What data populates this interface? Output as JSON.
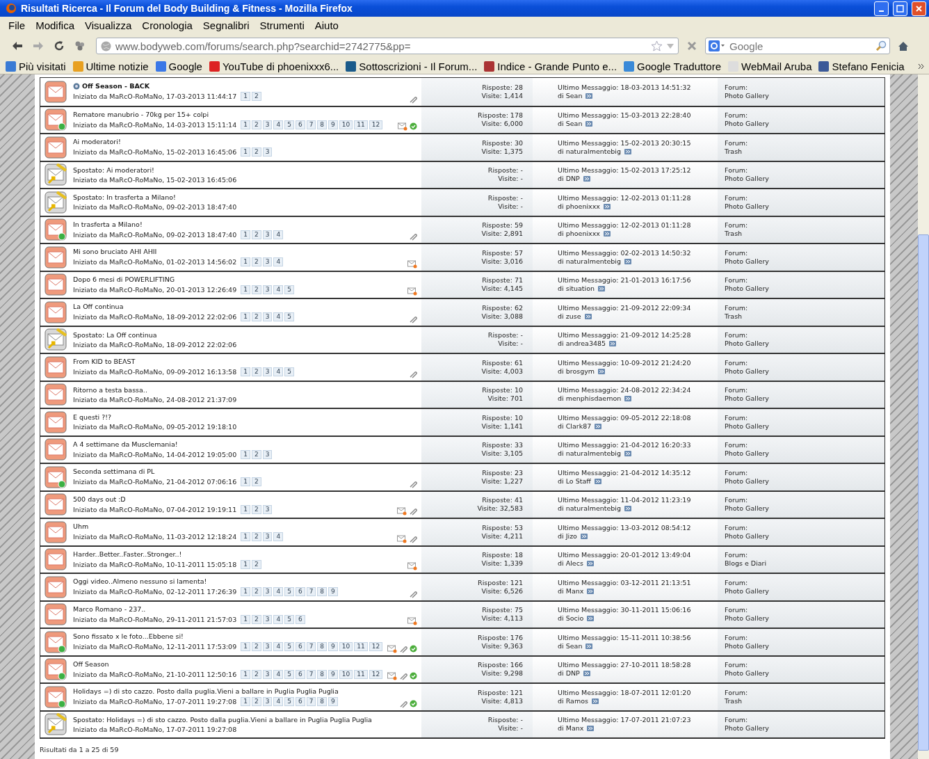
{
  "window": {
    "title": "Risultati Ricerca - Il Forum del Body Building & Fitness - Mozilla Firefox"
  },
  "menu": [
    "File",
    "Modifica",
    "Visualizza",
    "Cronologia",
    "Segnalibri",
    "Strumenti",
    "Aiuto"
  ],
  "address_bar": {
    "value": "www.bodyweb.com/forums/search.php?searchid=2742775&pp="
  },
  "search": {
    "placeholder": "Google"
  },
  "bookmarks": [
    "Più visitati",
    "Ultime notizie",
    "Google",
    "YouTube di phoenixxx6...",
    "Sottoscrizioni - Il Forum...",
    "Indice - Grande Punto e...",
    "Google Traduttore",
    "WebMail Aruba",
    "Stefano Fenicia"
  ],
  "threads": [
    {
      "kind": "topic",
      "unread": false,
      "highlighted": true,
      "title": "Off Season - BACK",
      "started": "Iniziato da MaRcO-RoMaNo, 17-03-2013 11:44:17",
      "pages": [
        "1",
        "2"
      ],
      "subscribed": false,
      "attachment": true,
      "posted": false,
      "replies": "Risposte: 28",
      "views": "Visite: 1,414",
      "last": "Ultimo Messaggio: 18-03-2013 14:51:32",
      "last_by": "di Sean",
      "forum_label": "Forum:",
      "forum": "Photo Gallery"
    },
    {
      "kind": "topic",
      "unread": true,
      "highlighted": false,
      "title": "Rematore manubrio - 70kg per 15+ colpi",
      "started": "Iniziato da MaRcO-RoMaNo, 14-03-2013 15:11:14",
      "pages": [
        "1",
        "2",
        "3",
        "4",
        "5",
        "6",
        "7",
        "8",
        "9",
        "10",
        "11",
        "12"
      ],
      "subscribed": true,
      "attachment": false,
      "posted": true,
      "replies": "Risposte: 178",
      "views": "Visite: 6,000",
      "last": "Ultimo Messaggio: 15-03-2013 22:28:40",
      "last_by": "di Sean",
      "forum_label": "Forum:",
      "forum": "Photo Gallery"
    },
    {
      "kind": "topic",
      "unread": false,
      "highlighted": false,
      "title": "Ai moderatori!",
      "started": "Iniziato da MaRcO-RoMaNo, 15-02-2013 16:45:06",
      "pages": [
        "1",
        "2",
        "3"
      ],
      "subscribed": false,
      "attachment": false,
      "posted": false,
      "replies": "Risposte: 30",
      "views": "Visite: 1,375",
      "last": "Ultimo Messaggio: 15-02-2013 20:30:15",
      "last_by": "di naturalmentebig",
      "forum_label": "Forum:",
      "forum": "Trash"
    },
    {
      "kind": "moved",
      "unread": false,
      "highlighted": false,
      "title": "Spostato: Ai moderatori!",
      "started": "Iniziato da MaRcO-RoMaNo, 15-02-2013 16:45:06",
      "subscribed": false,
      "attachment": false,
      "posted": false,
      "replies": "Risposte: -",
      "views": "Visite: -",
      "last": "Ultimo Messaggio: 15-02-2013 17:25:12",
      "last_by": "di DNP",
      "forum_label": "Forum:",
      "forum": "Photo Gallery"
    },
    {
      "kind": "moved",
      "unread": false,
      "highlighted": false,
      "title": "Spostato: In trasferta a Milano!",
      "started": "Iniziato da MaRcO-RoMaNo, 09-02-2013 18:47:40",
      "subscribed": false,
      "attachment": false,
      "posted": false,
      "replies": "Risposte: -",
      "views": "Visite: -",
      "last": "Ultimo Messaggio: 12-02-2013 01:11:28",
      "last_by": "di phoenixxx",
      "forum_label": "Forum:",
      "forum": "Photo Gallery"
    },
    {
      "kind": "topic",
      "unread": true,
      "highlighted": false,
      "title": "In trasferta a Milano!",
      "started": "Iniziato da MaRcO-RoMaNo, 09-02-2013 18:47:40",
      "pages": [
        "1",
        "2",
        "3",
        "4"
      ],
      "subscribed": false,
      "attachment": true,
      "posted": false,
      "replies": "Risposte: 59",
      "views": "Visite: 2,891",
      "last": "Ultimo Messaggio: 12-02-2013 01:11:28",
      "last_by": "di phoenixxx",
      "forum_label": "Forum:",
      "forum": "Trash"
    },
    {
      "kind": "topic",
      "unread": false,
      "highlighted": false,
      "title": "Mi sono bruciato AHI AHII",
      "started": "Iniziato da MaRcO-RoMaNo, 01-02-2013 14:56:02",
      "pages": [
        "1",
        "2",
        "3",
        "4"
      ],
      "subscribed": true,
      "attachment": false,
      "posted": false,
      "replies": "Risposte: 57",
      "views": "Visite: 3,016",
      "last": "Ultimo Messaggio: 02-02-2013 14:50:32",
      "last_by": "di naturalmentebig",
      "forum_label": "Forum:",
      "forum": "Photo Gallery"
    },
    {
      "kind": "topic",
      "unread": false,
      "highlighted": false,
      "title": "Dopo 6 mesi di POWERLIFTING",
      "started": "Iniziato da MaRcO-RoMaNo, 20-01-2013 12:26:49",
      "pages": [
        "1",
        "2",
        "3",
        "4",
        "5"
      ],
      "subscribed": true,
      "attachment": false,
      "posted": false,
      "replies": "Risposte: 71",
      "views": "Visite: 4,145",
      "last": "Ultimo Messaggio: 21-01-2013 16:17:56",
      "last_by": "di situation",
      "forum_label": "Forum:",
      "forum": "Photo Gallery"
    },
    {
      "kind": "topic",
      "unread": false,
      "highlighted": false,
      "title": "La Off continua",
      "started": "Iniziato da MaRcO-RoMaNo, 18-09-2012 22:02:06",
      "pages": [
        "1",
        "2",
        "3",
        "4",
        "5"
      ],
      "subscribed": false,
      "attachment": true,
      "posted": false,
      "replies": "Risposte: 62",
      "views": "Visite: 3,088",
      "last": "Ultimo Messaggio: 21-09-2012 22:09:34",
      "last_by": "di zuse",
      "forum_label": "Forum:",
      "forum": "Trash"
    },
    {
      "kind": "moved",
      "unread": false,
      "highlighted": false,
      "title": "Spostato: La Off continua",
      "started": "Iniziato da MaRcO-RoMaNo, 18-09-2012 22:02:06",
      "subscribed": false,
      "attachment": false,
      "posted": false,
      "replies": "Risposte: -",
      "views": "Visite: -",
      "last": "Ultimo Messaggio: 21-09-2012 14:25:28",
      "last_by": "di andrea3485",
      "forum_label": "Forum:",
      "forum": "Photo Gallery"
    },
    {
      "kind": "topic",
      "unread": false,
      "highlighted": false,
      "title": "From KID to BEAST",
      "started": "Iniziato da MaRcO-RoMaNo, 09-09-2012 16:13:58",
      "pages": [
        "1",
        "2",
        "3",
        "4",
        "5"
      ],
      "subscribed": false,
      "attachment": true,
      "posted": false,
      "replies": "Risposte: 61",
      "views": "Visite: 4,003",
      "last": "Ultimo Messaggio: 10-09-2012 21:24:20",
      "last_by": "di brosgym",
      "forum_label": "Forum:",
      "forum": "Photo Gallery"
    },
    {
      "kind": "topic",
      "unread": false,
      "highlighted": false,
      "title": "Ritorno a testa bassa..",
      "started": "Iniziato da MaRcO-RoMaNo, 24-08-2012 21:37:09",
      "subscribed": false,
      "attachment": false,
      "posted": false,
      "replies": "Risposte: 10",
      "views": "Visite: 701",
      "last": "Ultimo Messaggio: 24-08-2012 22:34:24",
      "last_by": "di menphisdaemon",
      "forum_label": "Forum:",
      "forum": "Photo Gallery"
    },
    {
      "kind": "topic",
      "unread": false,
      "highlighted": false,
      "title": "E questi ?!?",
      "started": "Iniziato da MaRcO-RoMaNo, 09-05-2012 19:18:10",
      "subscribed": false,
      "attachment": false,
      "posted": false,
      "replies": "Risposte: 10",
      "views": "Visite: 1,141",
      "last": "Ultimo Messaggio: 09-05-2012 22:18:08",
      "last_by": "di Clark87",
      "forum_label": "Forum:",
      "forum": "Photo Gallery"
    },
    {
      "kind": "topic",
      "unread": false,
      "highlighted": false,
      "title": "A 4 settimane da Musclemania!",
      "started": "Iniziato da MaRcO-RoMaNo, 14-04-2012 19:05:00",
      "pages": [
        "1",
        "2",
        "3"
      ],
      "subscribed": false,
      "attachment": false,
      "posted": false,
      "replies": "Risposte: 33",
      "views": "Visite: 3,105",
      "last": "Ultimo Messaggio: 21-04-2012 16:20:33",
      "last_by": "di naturalmentebig",
      "forum_label": "Forum:",
      "forum": "Photo Gallery"
    },
    {
      "kind": "topic",
      "unread": true,
      "highlighted": false,
      "title": "Seconda settimana di PL",
      "started": "Iniziato da MaRcO-RoMaNo, 21-04-2012 07:06:16",
      "pages": [
        "1",
        "2"
      ],
      "subscribed": false,
      "attachment": true,
      "posted": false,
      "replies": "Risposte: 23",
      "views": "Visite: 1,227",
      "last": "Ultimo Messaggio: 21-04-2012 14:35:12",
      "last_by": "di Lo Staff",
      "forum_label": "Forum:",
      "forum": "Photo Gallery"
    },
    {
      "kind": "topic",
      "unread": false,
      "highlighted": false,
      "title": "500 days out :D",
      "started": "Iniziato da MaRcO-RoMaNo, 07-04-2012 19:19:11",
      "pages": [
        "1",
        "2",
        "3"
      ],
      "subscribed": true,
      "attachment": true,
      "posted": false,
      "replies": "Risposte: 41",
      "views": "Visite: 32,583",
      "last": "Ultimo Messaggio: 11-04-2012 11:23:19",
      "last_by": "di naturalmentebig",
      "forum_label": "Forum:",
      "forum": "Photo Gallery"
    },
    {
      "kind": "topic",
      "unread": false,
      "highlighted": false,
      "title": "Uhm",
      "started": "Iniziato da MaRcO-RoMaNo, 11-03-2012 12:18:24",
      "pages": [
        "1",
        "2",
        "3",
        "4"
      ],
      "subscribed": true,
      "attachment": true,
      "posted": false,
      "replies": "Risposte: 53",
      "views": "Visite: 4,211",
      "last": "Ultimo Messaggio: 13-03-2012 08:54:12",
      "last_by": "di Jizo",
      "forum_label": "Forum:",
      "forum": "Photo Gallery"
    },
    {
      "kind": "topic",
      "unread": false,
      "highlighted": false,
      "title": "Harder..Better..Faster..Stronger..!",
      "started": "Iniziato da MaRcO-RoMaNo, 10-11-2011 15:05:18",
      "pages": [
        "1",
        "2"
      ],
      "subscribed": true,
      "attachment": false,
      "posted": false,
      "replies": "Risposte: 18",
      "views": "Visite: 1,339",
      "last": "Ultimo Messaggio: 20-01-2012 13:49:04",
      "last_by": "di Alecs",
      "forum_label": "Forum:",
      "forum": "Blogs e Diari"
    },
    {
      "kind": "topic",
      "unread": false,
      "highlighted": false,
      "title": "Oggi video..Almeno nessuno si lamenta!",
      "started": "Iniziato da MaRcO-RoMaNo, 02-12-2011 17:26:39",
      "pages": [
        "1",
        "2",
        "3",
        "4",
        "5",
        "6",
        "7",
        "8",
        "9"
      ],
      "subscribed": false,
      "attachment": true,
      "posted": false,
      "replies": "Risposte: 121",
      "views": "Visite: 6,526",
      "last": "Ultimo Messaggio: 03-12-2011 21:13:51",
      "last_by": "di Manx",
      "forum_label": "Forum:",
      "forum": "Photo Gallery"
    },
    {
      "kind": "topic",
      "unread": false,
      "highlighted": false,
      "title": "Marco Romano - 237..",
      "started": "Iniziato da MaRcO-RoMaNo, 29-11-2011 21:57:03",
      "pages": [
        "1",
        "2",
        "3",
        "4",
        "5",
        "6"
      ],
      "subscribed": true,
      "attachment": false,
      "posted": false,
      "replies": "Risposte: 75",
      "views": "Visite: 4,113",
      "last": "Ultimo Messaggio: 30-11-2011 15:06:16",
      "last_by": "di Socio",
      "forum_label": "Forum:",
      "forum": "Photo Gallery"
    },
    {
      "kind": "topic",
      "unread": true,
      "highlighted": false,
      "title": "Sono fissato x le foto...Ebbene si!",
      "started": "Iniziato da MaRcO-RoMaNo, 12-11-2011 17:53:09",
      "pages": [
        "1",
        "2",
        "3",
        "4",
        "5",
        "6",
        "7",
        "8",
        "9",
        "10",
        "11",
        "12"
      ],
      "subscribed": true,
      "attachment": true,
      "posted": true,
      "replies": "Risposte: 176",
      "views": "Visite: 9,363",
      "last": "Ultimo Messaggio: 15-11-2011 10:38:56",
      "last_by": "di Sean",
      "forum_label": "Forum:",
      "forum": "Photo Gallery"
    },
    {
      "kind": "topic",
      "unread": true,
      "highlighted": false,
      "title": "Off Season",
      "started": "Iniziato da MaRcO-RoMaNo, 21-10-2011 12:50:16",
      "pages": [
        "1",
        "2",
        "3",
        "4",
        "5",
        "6",
        "7",
        "8",
        "9",
        "10",
        "11",
        "12"
      ],
      "subscribed": true,
      "attachment": true,
      "posted": true,
      "replies": "Risposte: 166",
      "views": "Visite: 9,298",
      "last": "Ultimo Messaggio: 27-10-2011 18:58:28",
      "last_by": "di DNP",
      "forum_label": "Forum:",
      "forum": "Photo Gallery"
    },
    {
      "kind": "topic",
      "unread": true,
      "highlighted": false,
      "title": "Holidays =) di sto cazzo. Posto dalla puglia.Vieni a ballare in Puglia Puglia Puglia",
      "started": "Iniziato da MaRcO-RoMaNo, 17-07-2011 19:27:08",
      "pages": [
        "1",
        "2",
        "3",
        "4",
        "5",
        "6",
        "7",
        "8",
        "9"
      ],
      "subscribed": false,
      "attachment": true,
      "posted": true,
      "replies": "Risposte: 121",
      "views": "Visite: 4,813",
      "last": "Ultimo Messaggio: 18-07-2011 12:01:20",
      "last_by": "di Ramos",
      "forum_label": "Forum:",
      "forum": "Trash"
    },
    {
      "kind": "moved",
      "unread": false,
      "highlighted": false,
      "title": "Spostato: Holidays =) di sto cazzo. Posto dalla puglia.Vieni a ballare in Puglia Puglia Puglia",
      "started": "Iniziato da MaRcO-RoMaNo, 17-07-2011 19:27:08",
      "subscribed": false,
      "attachment": false,
      "posted": false,
      "replies": "Risposte: -",
      "views": "Visite: -",
      "last": "Ultimo Messaggio: 17-07-2011 21:07:23",
      "last_by": "di Manx",
      "forum_label": "Forum:",
      "forum": "Photo Gallery"
    }
  ],
  "footer": "Risultati da 1 a 25 di 59"
}
